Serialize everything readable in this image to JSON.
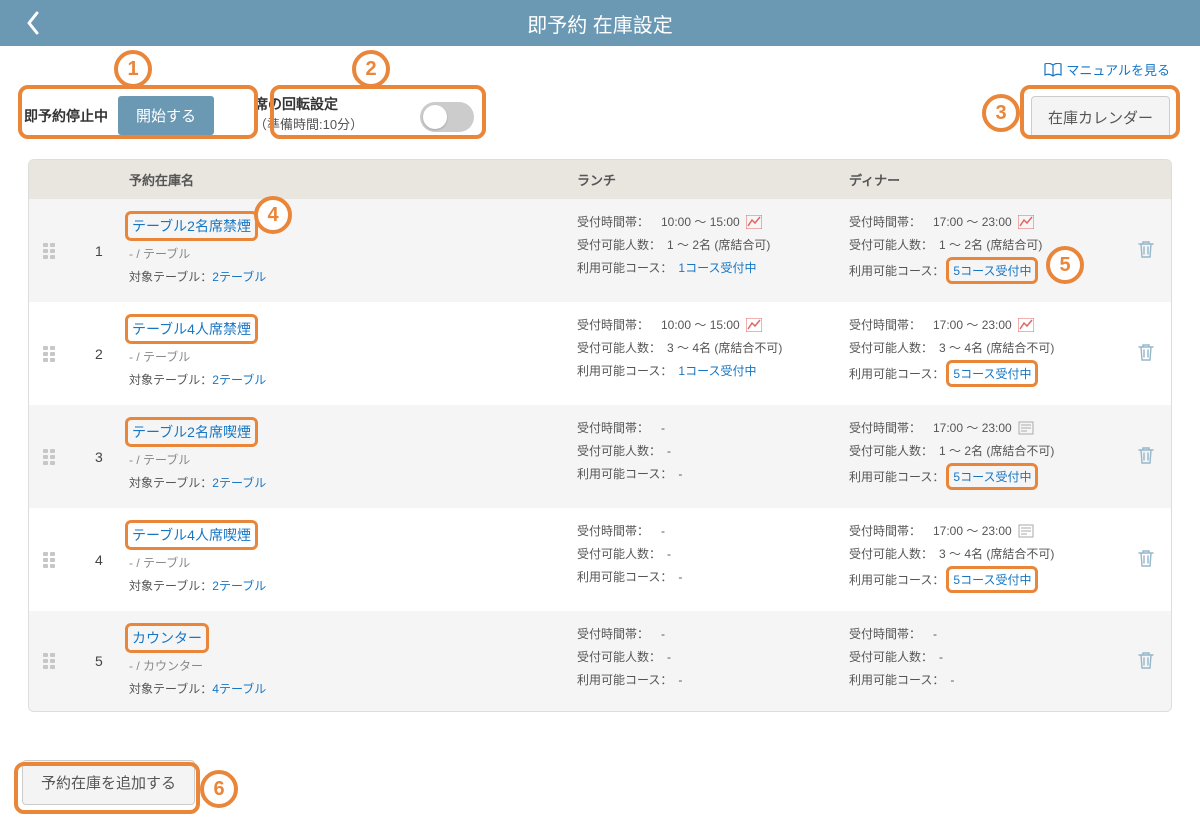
{
  "header": {
    "title": "即予約 在庫設定"
  },
  "toolbar": {
    "manual_link": "マニュアルを見る",
    "status_label": "即予約停止中",
    "start_button": "開始する",
    "rotation_title": "席の回転設定",
    "rotation_sub": "（準備時間:10分）",
    "calendar_button": "在庫カレンダー"
  },
  "columns": {
    "stock": "予約在庫名",
    "lunch": "ランチ",
    "dinner": "ディナー"
  },
  "labels": {
    "time": "受付時間帯：",
    "capacity": "受付可能人数：",
    "course": "利用可能コース：",
    "target_table": "対象テーブル："
  },
  "rows": [
    {
      "index": "1",
      "name": "テーブル2名席禁煙",
      "sub": "- / テーブル",
      "target_tables": "2テーブル",
      "lunch": {
        "time": "10:00 〜 15:00",
        "time_icon": true,
        "capacity": "1 〜 2名 (席結合可)",
        "course": "1コース受付中",
        "course_link": true
      },
      "dinner": {
        "time": "17:00 〜 23:00",
        "time_icon": true,
        "capacity": "1 〜 2名 (席結合可)",
        "course": "5コース受付中",
        "course_link": true,
        "course_highlight": true
      }
    },
    {
      "index": "2",
      "name": "テーブル4人席禁煙",
      "sub": "- / テーブル",
      "target_tables": "2テーブル",
      "lunch": {
        "time": "10:00 〜 15:00",
        "time_icon": true,
        "capacity": "3 〜 4名 (席結合不可)",
        "course": "1コース受付中",
        "course_link": true
      },
      "dinner": {
        "time": "17:00 〜 23:00",
        "time_icon": true,
        "capacity": "3 〜 4名 (席結合不可)",
        "course": "5コース受付中",
        "course_link": true,
        "course_highlight": true
      }
    },
    {
      "index": "3",
      "name": "テーブル2名席喫煙",
      "sub": "- / テーブル",
      "target_tables": "2テーブル",
      "lunch": {
        "time": "-",
        "capacity": "-",
        "course": "-"
      },
      "dinner": {
        "time": "17:00 〜 23:00",
        "time_icon2": true,
        "capacity": "1 〜 2名 (席結合不可)",
        "course": "5コース受付中",
        "course_link": true,
        "course_highlight": true
      }
    },
    {
      "index": "4",
      "name": "テーブル4人席喫煙",
      "sub": "- / テーブル",
      "target_tables": "2テーブル",
      "lunch": {
        "time": "-",
        "capacity": "-",
        "course": "-"
      },
      "dinner": {
        "time": "17:00 〜 23:00",
        "time_icon2": true,
        "capacity": "3 〜 4名 (席結合不可)",
        "course": "5コース受付中",
        "course_link": true,
        "course_highlight": true
      }
    },
    {
      "index": "5",
      "name": "カウンター",
      "sub": "- / カウンター",
      "target_tables": "4テーブル",
      "lunch": {
        "time": "-",
        "capacity": "-",
        "course": "-"
      },
      "dinner": {
        "time": "-",
        "capacity": "-",
        "course": "-"
      }
    }
  ],
  "footer": {
    "add_button": "予約在庫を追加する"
  },
  "annotations": {
    "n1": "1",
    "n2": "2",
    "n3": "3",
    "n4": "4",
    "n5": "5",
    "n6": "6"
  }
}
